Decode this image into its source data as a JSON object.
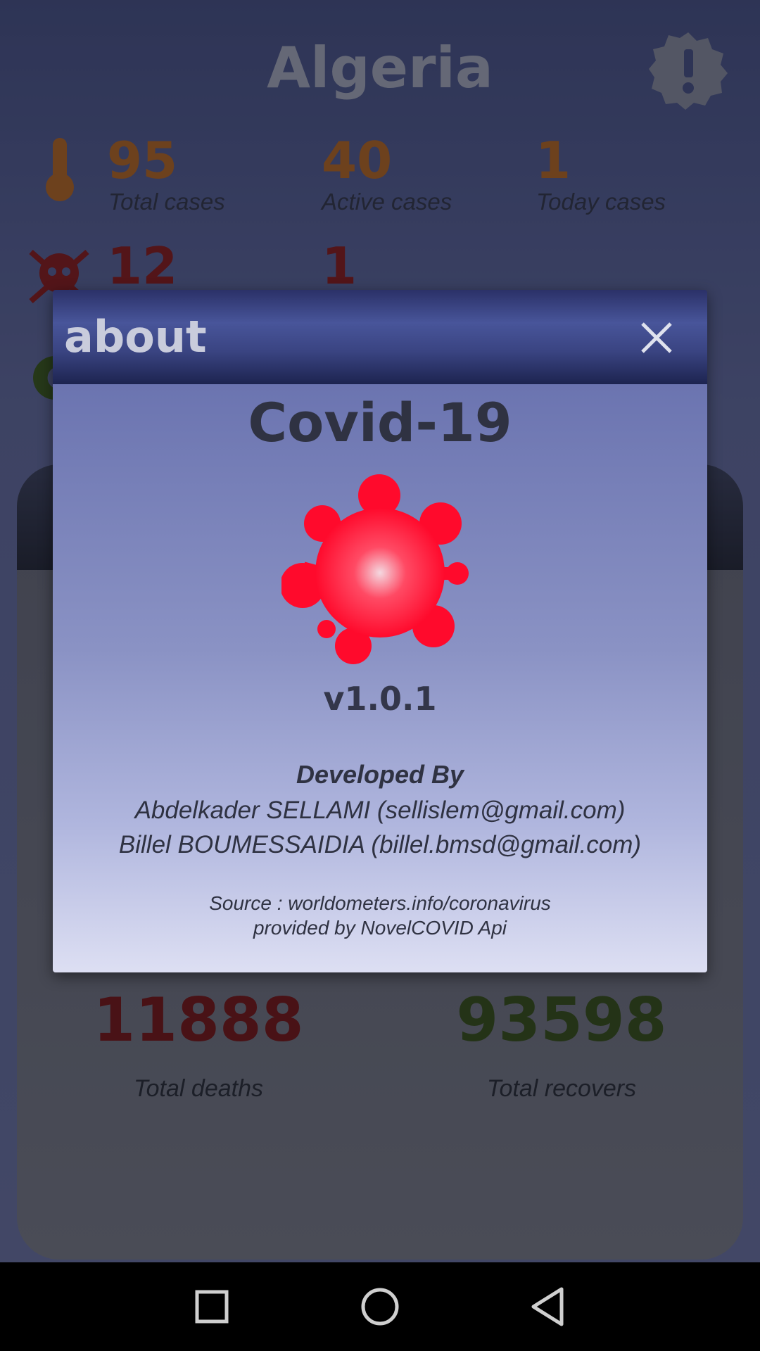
{
  "app": {
    "country": "Algeria",
    "alert_icon": "alert-badge-icon"
  },
  "stats": {
    "total_cases": {
      "value": "95",
      "label": "Total cases"
    },
    "active_cases": {
      "value": "40",
      "label": "Active cases"
    },
    "today_cases": {
      "value": "1",
      "label": "Today cases"
    },
    "deaths_value": "12",
    "today_deaths_value": "1"
  },
  "global": {
    "total_deaths": {
      "value": "11888",
      "label": "Total deaths"
    },
    "total_recovers": {
      "value": "93598",
      "label": "Total recovers"
    }
  },
  "dialog": {
    "title": "about",
    "app_name": "Covid-19",
    "version": "v1.0.1",
    "developed_by": "Developed By",
    "developers": [
      "Abdelkader SELLAMI (sellislem@gmail.com)",
      "Billel BOUMESSAIDIA (billel.bmsd@gmail.com)"
    ],
    "source": "Source : worldometers.info/coronavirus",
    "provider": "provided by NovelCOVID Api"
  },
  "colors": {
    "cases": "#a85a16",
    "deaths": "#7a0e0e",
    "recovers": "#2e4a0e",
    "virus": "#ff1030"
  },
  "navbar": [
    "recents-button",
    "home-button",
    "back-button"
  ]
}
